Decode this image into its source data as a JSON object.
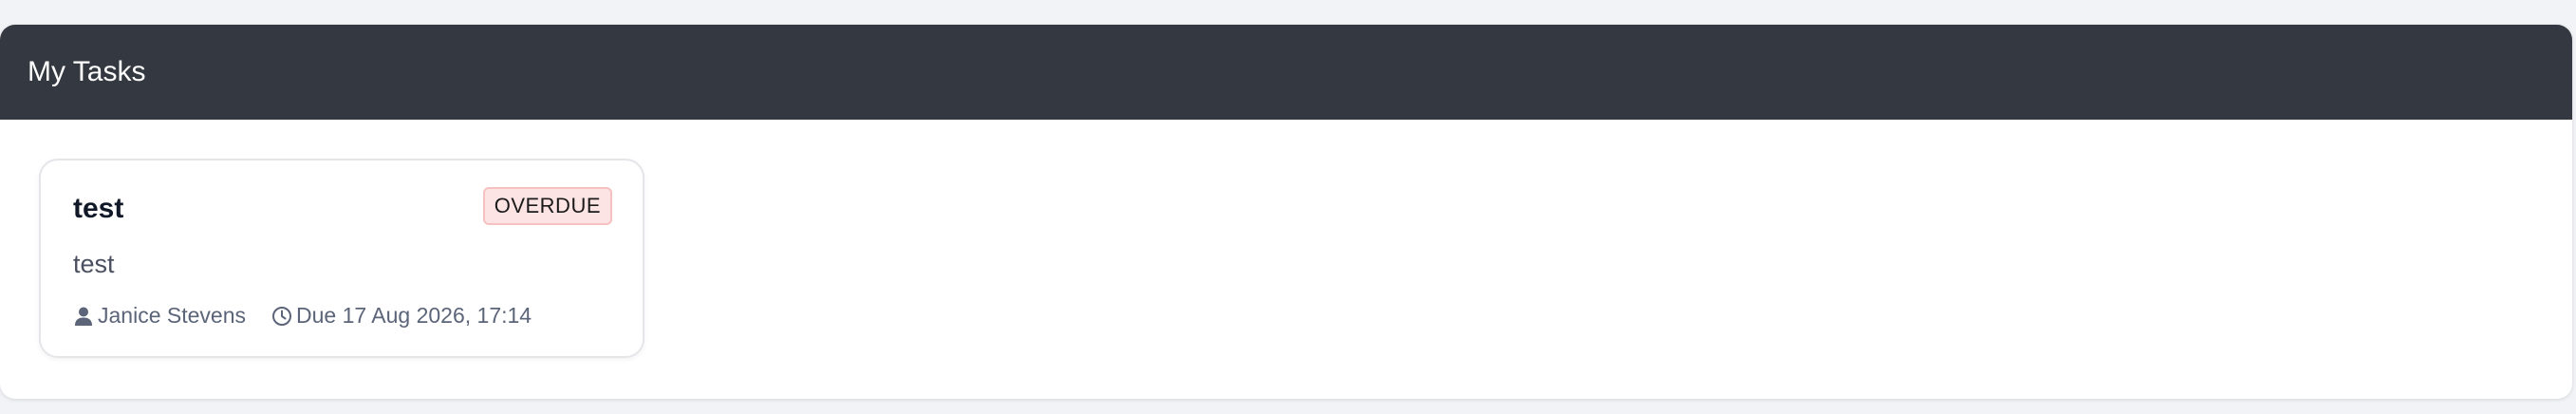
{
  "panel": {
    "title": "My Tasks"
  },
  "tasks": [
    {
      "title": "test",
      "status": "OVERDUE",
      "description": "test",
      "assignee": "Janice Stevens",
      "due": "Due 17 Aug 2026, 17:14",
      "assignee_icon": "user-icon",
      "due_icon": "clock-icon"
    }
  ],
  "colors": {
    "header_bg": "#343840",
    "badge_bg": "#fde4e4",
    "badge_border": "#f6c1c1",
    "meta_text": "#5b6478"
  }
}
